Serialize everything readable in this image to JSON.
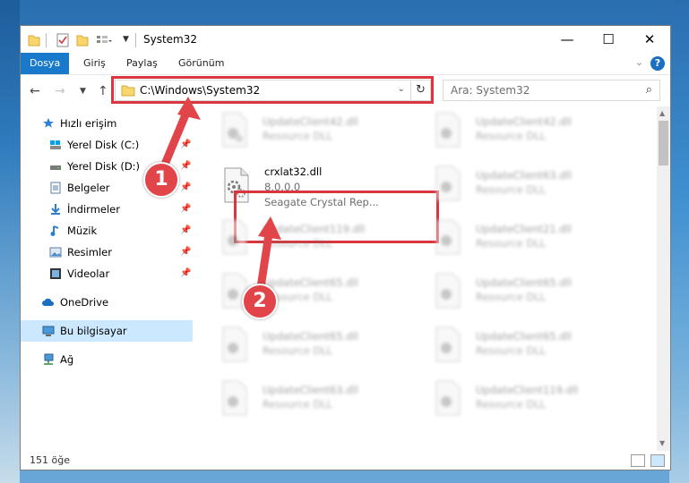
{
  "window": {
    "title": "System32",
    "controls": {
      "minimize": "—",
      "maximize": "☐",
      "close": "✕"
    }
  },
  "ribbon": {
    "tabs": [
      {
        "label": "Dosya",
        "active": true
      },
      {
        "label": "Giriş"
      },
      {
        "label": "Paylaş"
      },
      {
        "label": "Görünüm"
      }
    ],
    "help": "?"
  },
  "navigation": {
    "address": "C:\\Windows\\System32",
    "search_placeholder": "Ara: System32"
  },
  "sidebar": {
    "items": [
      {
        "label": "Hızlı erişim",
        "icon": "star-icon",
        "pinned": false
      },
      {
        "label": "Yerel Disk (C:)",
        "icon": "drive-icon",
        "pinned": true
      },
      {
        "label": "Yerel Disk (D:)",
        "icon": "drive-icon",
        "pinned": true
      },
      {
        "label": "Belgeler",
        "icon": "documents-icon",
        "pinned": true
      },
      {
        "label": "İndirmeler",
        "icon": "downloads-icon",
        "pinned": true
      },
      {
        "label": "Müzik",
        "icon": "music-icon",
        "pinned": true
      },
      {
        "label": "Resimler",
        "icon": "pictures-icon",
        "pinned": true
      },
      {
        "label": "Videolar",
        "icon": "videos-icon",
        "pinned": true
      },
      {
        "label": "OneDrive",
        "icon": "cloud-icon"
      },
      {
        "label": "Bu bilgisayar",
        "icon": "computer-icon",
        "selected": true
      },
      {
        "label": "Ağ",
        "icon": "network-icon"
      }
    ]
  },
  "files": {
    "highlighted": {
      "name": "crxlat32.dll",
      "version": "8.0.0.0",
      "description": "Seagate Crystal Rep..."
    },
    "blurred": [
      {
        "name": "UpdateClient42.dll",
        "description": "Resource DLL"
      },
      {
        "name": "UpdateClient42.dll",
        "description": "Resource DLL"
      },
      {
        "name": "UpdateClient63.dll",
        "description": "Resource DLL"
      },
      {
        "name": "UpdateClient119.dll",
        "description": "Resource DLL"
      },
      {
        "name": "UpdateClient21.dll",
        "description": "Resource DLL"
      },
      {
        "name": "UpdateClient65.dll",
        "description": "Resource DLL"
      },
      {
        "name": "UpdateClient65.dll",
        "description": "Resource DLL"
      },
      {
        "name": "UpdateClient65.dll",
        "description": "Resource DLL"
      },
      {
        "name": "UpdateClient65.dll",
        "description": "Resource DLL"
      },
      {
        "name": "UpdateClient63.dll",
        "description": "Resource DLL"
      },
      {
        "name": "UpdateClient119.dll",
        "description": "Resource DLL"
      }
    ]
  },
  "status": {
    "item_count": "151 öğe"
  },
  "annotations": {
    "step1": "1",
    "step2": "2",
    "highlight_color": "#d9363e",
    "badge_color": "#e1454a"
  }
}
